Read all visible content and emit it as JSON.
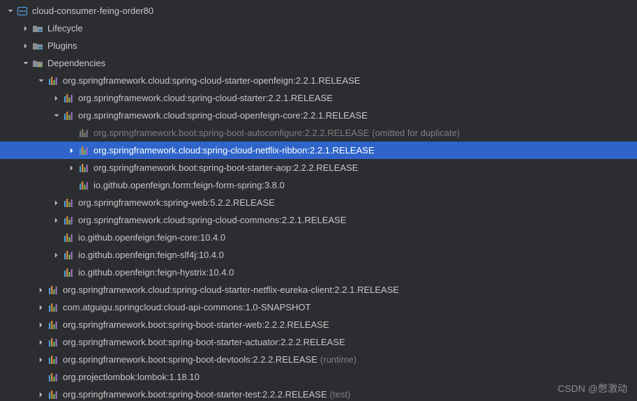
{
  "watermark": "CSDN @憋激动",
  "colors": {
    "underline": "#d0453a",
    "selection": "#2f65ca"
  },
  "tree": [
    {
      "depth": 0,
      "expand": "down",
      "icon": "module",
      "label": "cloud-consumer-feing-order80"
    },
    {
      "depth": 1,
      "expand": "right",
      "icon": "folder-cog",
      "label": "Lifecycle"
    },
    {
      "depth": 1,
      "expand": "right",
      "icon": "folder-cog",
      "label": "Plugins"
    },
    {
      "depth": 1,
      "expand": "down",
      "icon": "folder-lib",
      "label": "Dependencies"
    },
    {
      "depth": 2,
      "expand": "down",
      "icon": "lib",
      "label_parts": [
        {
          "t": "org.springframework.cloud:spring-cloud-starter"
        },
        {
          "t": "-openfeign:2.2.1.RELEA",
          "ul": true
        },
        {
          "t": "SE"
        }
      ]
    },
    {
      "depth": 3,
      "expand": "right",
      "icon": "lib",
      "label": "org.springframework.cloud:spring-cloud-starter:2.2.1.RELEASE"
    },
    {
      "depth": 3,
      "expand": "down",
      "icon": "lib",
      "label": "org.springframework.cloud:spring-cloud-openfeign-core:2.2.1.RELEASE"
    },
    {
      "depth": 4,
      "expand": "none",
      "icon": "lib",
      "dim": true,
      "label": "org.springframework.boot:spring-boot-autoconfigure:2.2.2.RELEASE",
      "suffix": "(omitted for duplicate)"
    },
    {
      "depth": 4,
      "expand": "right",
      "icon": "lib",
      "selected": true,
      "label_parts": [
        {
          "t": "org.springframework.clou"
        },
        {
          "t": "d:spring-cloud-netflix-ribbon:2.2.",
          "ul": true
        },
        {
          "t": "1.RELEASE"
        }
      ]
    },
    {
      "depth": 4,
      "expand": "right",
      "icon": "lib",
      "label": "org.springframework.boot:spring-boot-starter-aop:2.2.2.RELEASE"
    },
    {
      "depth": 4,
      "expand": "none",
      "icon": "lib",
      "label": "io.github.openfeign.form:feign-form-spring:3.8.0"
    },
    {
      "depth": 3,
      "expand": "right",
      "icon": "lib",
      "label": "org.springframework:spring-web:5.2.2.RELEASE"
    },
    {
      "depth": 3,
      "expand": "right",
      "icon": "lib",
      "label": "org.springframework.cloud:spring-cloud-commons:2.2.1.RELEASE"
    },
    {
      "depth": 3,
      "expand": "none",
      "icon": "lib",
      "label": "io.github.openfeign:feign-core:10.4.0"
    },
    {
      "depth": 3,
      "expand": "right",
      "icon": "lib",
      "label": "io.github.openfeign:feign-slf4j:10.4.0"
    },
    {
      "depth": 3,
      "expand": "none",
      "icon": "lib",
      "label": "io.github.openfeign:feign-hystrix:10.4.0"
    },
    {
      "depth": 2,
      "expand": "right",
      "icon": "lib",
      "label": "org.springframework.cloud:spring-cloud-starter-netflix-eureka-client:2.2.1.RELEASE"
    },
    {
      "depth": 2,
      "expand": "right",
      "icon": "lib",
      "label": "com.atguigu.springcloud:cloud-api-commons:1.0-SNAPSHOT"
    },
    {
      "depth": 2,
      "expand": "right",
      "icon": "lib",
      "label": "org.springframework.boot:spring-boot-starter-web:2.2.2.RELEASE"
    },
    {
      "depth": 2,
      "expand": "right",
      "icon": "lib",
      "label": "org.springframework.boot:spring-boot-starter-actuator:2.2.2.RELEASE"
    },
    {
      "depth": 2,
      "expand": "right",
      "icon": "lib",
      "label": "org.springframework.boot:spring-boot-devtools:2.2.2.RELEASE",
      "suffix": "(runtime)",
      "dimSuffix": true
    },
    {
      "depth": 2,
      "expand": "none",
      "icon": "lib",
      "label": "org.projectlombok:lombok:1.18.10"
    },
    {
      "depth": 2,
      "expand": "right",
      "icon": "lib",
      "label": "org.springframework.boot:spring-boot-starter-test:2.2.2.RELEASE",
      "suffix": "(test)",
      "dimSuffix": true
    }
  ]
}
